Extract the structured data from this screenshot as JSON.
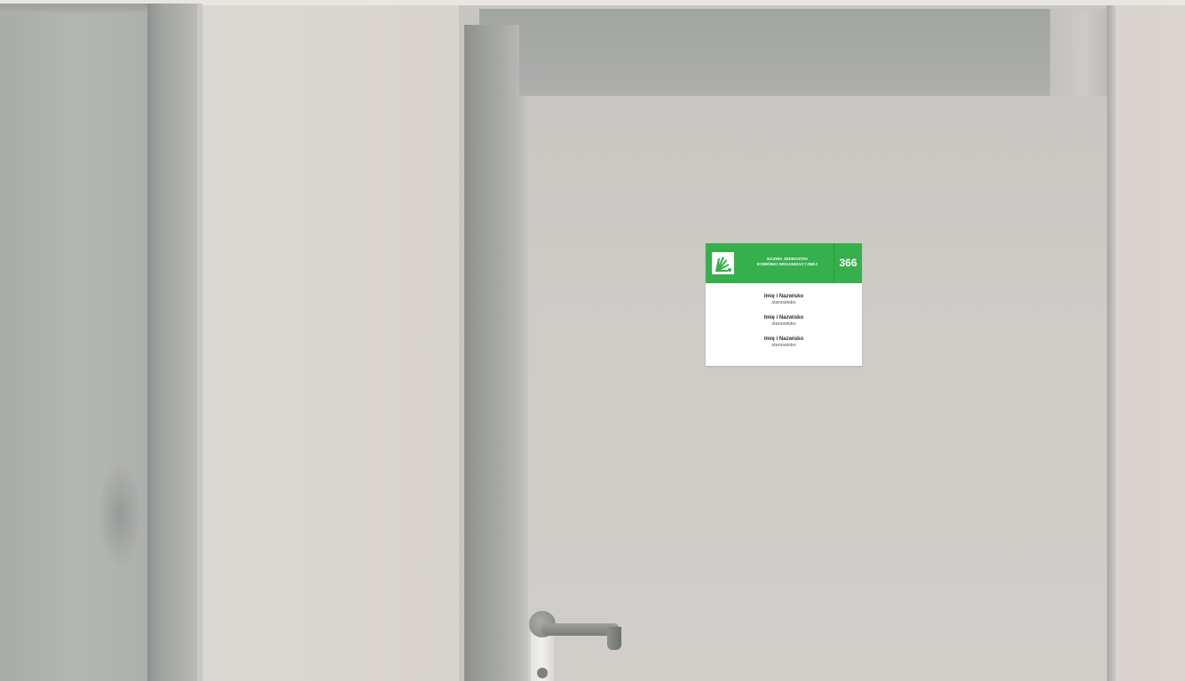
{
  "sign": {
    "logo": "green-emblem-icon",
    "unit_line1": "NAZWA JEDNOSTKI",
    "unit_line2": "KOMÓRKI ORGANIZACYJNEJ",
    "room_number": "366",
    "people": [
      {
        "name": "Imię i Nazwisko",
        "role": "stanowisko"
      },
      {
        "name": "Imię i Nazwisko",
        "role": "stanowisko"
      },
      {
        "name": "Imię i Nazwisko",
        "role": "stanowisko"
      }
    ]
  },
  "colors": {
    "sign_green": "#35b04c",
    "sign_background": "#ffffff",
    "wall": "#d7d2cd",
    "door": "#cdcac6"
  }
}
